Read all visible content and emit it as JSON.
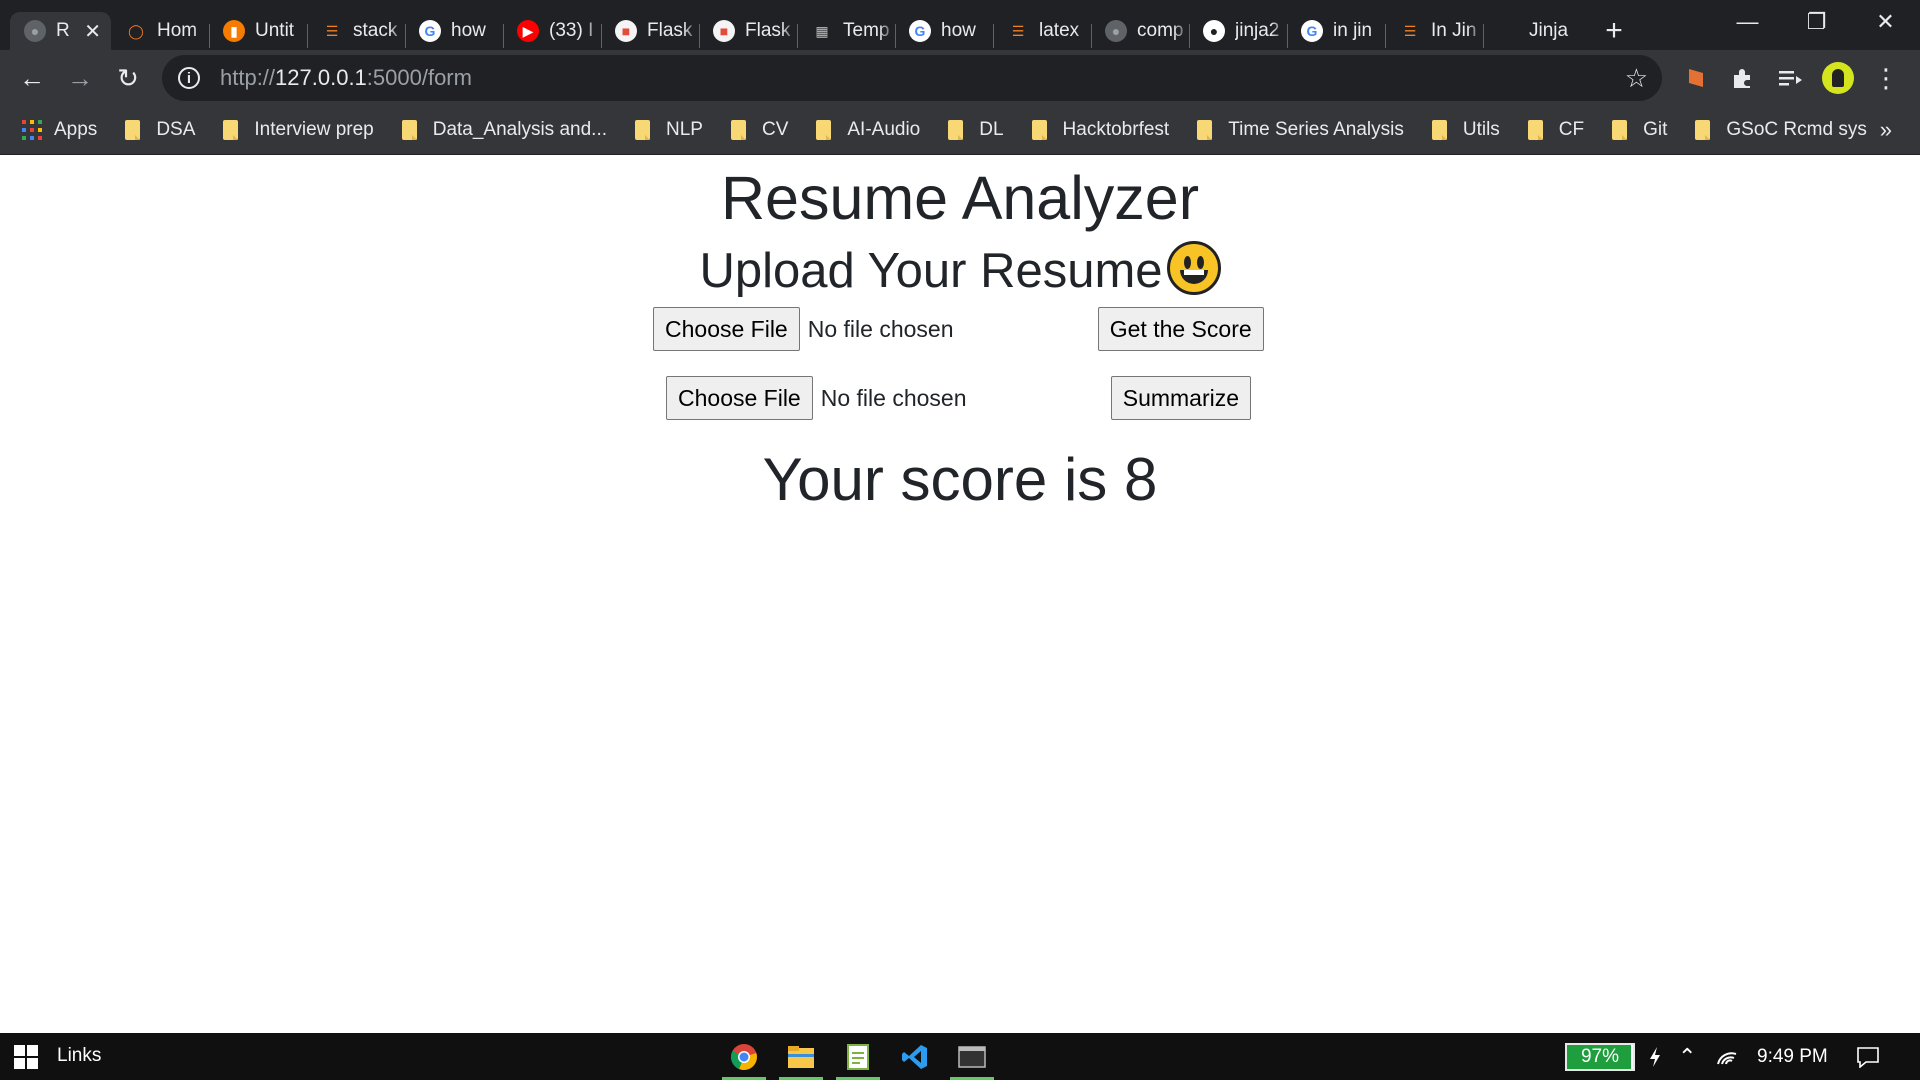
{
  "browser": {
    "tabs": [
      {
        "title": "R",
        "icon": "globe-icon",
        "active": true
      },
      {
        "title": "Hom",
        "icon": "jupyter-icon"
      },
      {
        "title": "Untit",
        "icon": "notebook-icon"
      },
      {
        "title": "stack",
        "icon": "stackoverflow-icon"
      },
      {
        "title": "how",
        "icon": "google-icon"
      },
      {
        "title": "(33) I",
        "icon": "youtube-icon"
      },
      {
        "title": "Flask",
        "icon": "flask-icon"
      },
      {
        "title": "Flask",
        "icon": "flask-icon"
      },
      {
        "title": "Temp",
        "icon": "building-icon"
      },
      {
        "title": "how",
        "icon": "google-icon"
      },
      {
        "title": "latex",
        "icon": "stackoverflow-icon"
      },
      {
        "title": "comp",
        "icon": "globe-icon"
      },
      {
        "title": "jinja2",
        "icon": "github-icon"
      },
      {
        "title": "in jin",
        "icon": "google-icon"
      },
      {
        "title": "In Jin",
        "icon": "stackoverflow-icon"
      },
      {
        "title": "Jinja",
        "icon": "blank-icon"
      }
    ],
    "url": {
      "scheme": "http://",
      "host": "127.0.0.1",
      "rest": ":5000/form"
    },
    "bookmarks": [
      {
        "label": "Apps",
        "icon": "apps-grid-icon"
      },
      {
        "label": "DSA",
        "icon": "folder-icon"
      },
      {
        "label": "Interview prep",
        "icon": "folder-icon"
      },
      {
        "label": "Data_Analysis and...",
        "icon": "folder-icon"
      },
      {
        "label": "NLP",
        "icon": "folder-icon"
      },
      {
        "label": "CV",
        "icon": "folder-icon"
      },
      {
        "label": "AI-Audio",
        "icon": "folder-icon"
      },
      {
        "label": "DL",
        "icon": "folder-icon"
      },
      {
        "label": "Hacktobrfest",
        "icon": "folder-icon"
      },
      {
        "label": "Time Series Analysis",
        "icon": "folder-icon"
      },
      {
        "label": "Utils",
        "icon": "folder-icon"
      },
      {
        "label": "CF",
        "icon": "folder-icon"
      },
      {
        "label": "Git",
        "icon": "folder-icon"
      },
      {
        "label": "GSoC Rcmd sys",
        "icon": "folder-icon"
      }
    ],
    "more_label": "»"
  },
  "page": {
    "title": "Resume Analyzer",
    "subtitle": "Upload Your Resume",
    "subtitle_emoji": "grinning-face-icon",
    "form1": {
      "file_button": "Choose File",
      "file_status": "No file chosen",
      "submit": "Get the Score"
    },
    "form2": {
      "file_button": "Choose File",
      "file_status": "No file chosen",
      "submit": "Summarize"
    },
    "result": "Your score is 8"
  },
  "taskbar": {
    "start_label": "Links",
    "apps": [
      "chrome-icon",
      "file-explorer-icon",
      "notepad-icon",
      "vscode-icon",
      "terminal-icon"
    ],
    "battery_percent": 97,
    "battery_text": "97%",
    "time": "9:49 PM"
  },
  "colors": {
    "tab_bg": "#202124",
    "toolbar_bg": "#35363a",
    "text": "#212529",
    "battery_green": "#1e9e3c"
  }
}
